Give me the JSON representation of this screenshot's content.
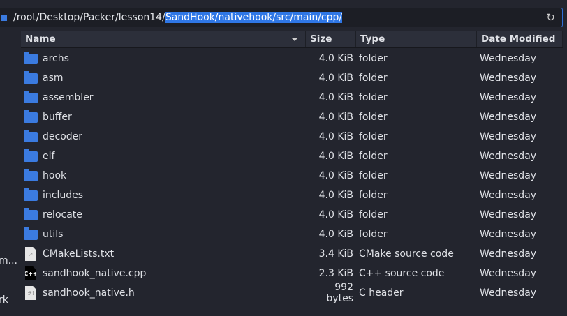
{
  "address": {
    "path_prefix": "/root/Desktop/Packer/lesson14/",
    "path_selected": "SandHook/nativehook/src/main/cpp/",
    "reload_icon": "reload-icon"
  },
  "sidebar": {
    "items": [
      "m...",
      "rk"
    ]
  },
  "columns": {
    "name": "Name",
    "size": "Size",
    "type": "Type",
    "date": "Date Modified"
  },
  "files": [
    {
      "name": "archs",
      "size": "4.0 KiB",
      "type": "folder",
      "date": "Wednesday",
      "icon": "folder"
    },
    {
      "name": "asm",
      "size": "4.0 KiB",
      "type": "folder",
      "date": "Wednesday",
      "icon": "folder"
    },
    {
      "name": "assembler",
      "size": "4.0 KiB",
      "type": "folder",
      "date": "Wednesday",
      "icon": "folder"
    },
    {
      "name": "buffer",
      "size": "4.0 KiB",
      "type": "folder",
      "date": "Wednesday",
      "icon": "folder"
    },
    {
      "name": "decoder",
      "size": "4.0 KiB",
      "type": "folder",
      "date": "Wednesday",
      "icon": "folder"
    },
    {
      "name": "elf",
      "size": "4.0 KiB",
      "type": "folder",
      "date": "Wednesday",
      "icon": "folder"
    },
    {
      "name": "hook",
      "size": "4.0 KiB",
      "type": "folder",
      "date": "Wednesday",
      "icon": "folder"
    },
    {
      "name": "includes",
      "size": "4.0 KiB",
      "type": "folder",
      "date": "Wednesday",
      "icon": "folder"
    },
    {
      "name": "relocate",
      "size": "4.0 KiB",
      "type": "folder",
      "date": "Wednesday",
      "icon": "folder"
    },
    {
      "name": "utils",
      "size": "4.0 KiB",
      "type": "folder",
      "date": "Wednesday",
      "icon": "folder"
    },
    {
      "name": "CMakeLists.txt",
      "size": "3.4 KiB",
      "type": "CMake source code",
      "date": "Wednesday",
      "icon": "txt"
    },
    {
      "name": "sandhook_native.cpp",
      "size": "2.3 KiB",
      "type": "C++ source code",
      "date": "Wednesday",
      "icon": "cpp",
      "glyph": "C++"
    },
    {
      "name": "sandhook_native.h",
      "size": "992 bytes",
      "type": "C header",
      "date": "Wednesday",
      "icon": "h",
      "glyph": "#!"
    }
  ]
}
